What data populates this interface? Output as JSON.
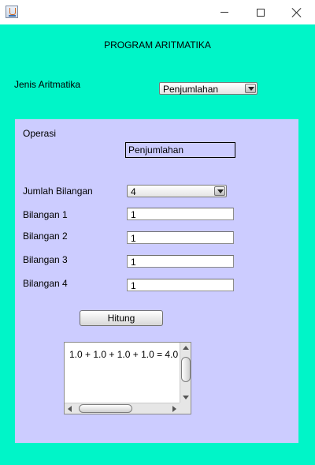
{
  "window": {
    "app_icon": "java-cup-icon",
    "minimize_icon": "minimize-icon",
    "maximize_icon": "maximize-icon",
    "close_icon": "close-icon"
  },
  "colors": {
    "content_bg": "#00f5c8",
    "panel_bg": "#ccccff"
  },
  "header": {
    "title": "PROGRAM ARITMATIKA"
  },
  "jenis": {
    "label": "Jenis Aritmatika",
    "selected": "Penjumlahan"
  },
  "panel": {
    "operasi_label": "Operasi",
    "operasi_value": "Penjumlahan",
    "jumlah_label": "Jumlah Bilangan",
    "jumlah_selected": "4",
    "bilangan": [
      {
        "label": "Bilangan 1",
        "value": "1"
      },
      {
        "label": "Bilangan 2",
        "value": "1"
      },
      {
        "label": "Bilangan 3",
        "value": "1"
      },
      {
        "label": "Bilangan 4",
        "value": "1"
      }
    ],
    "hitung_label": "Hitung",
    "result": "1.0 + 1.0 + 1.0 + 1.0 = 4.0"
  }
}
